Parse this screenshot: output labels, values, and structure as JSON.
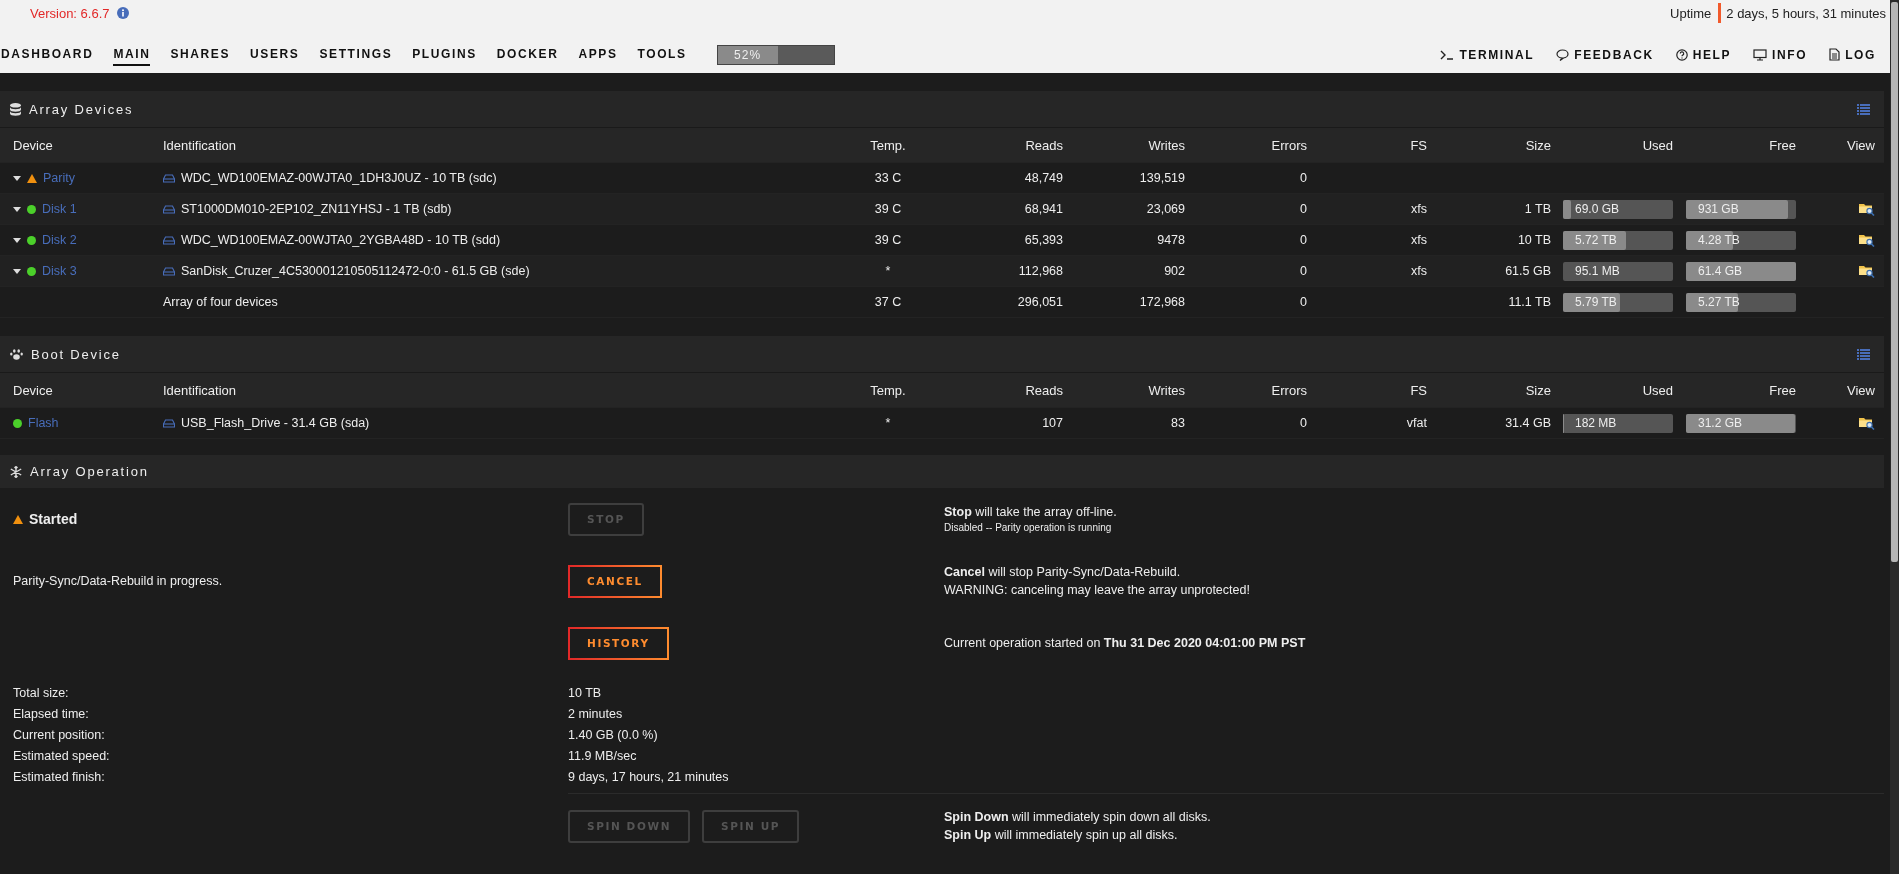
{
  "header": {
    "version": "Version: 6.6.7",
    "uptime_label": "Uptime",
    "uptime": "2 days, 5 hours, 31 minutes"
  },
  "nav": {
    "tabs": [
      {
        "label": "DASHBOARD",
        "selected": false
      },
      {
        "label": "MAIN",
        "selected": true
      },
      {
        "label": "SHARES",
        "selected": false
      },
      {
        "label": "USERS",
        "selected": false
      },
      {
        "label": "SETTINGS",
        "selected": false
      },
      {
        "label": "PLUGINS",
        "selected": false
      },
      {
        "label": "DOCKER",
        "selected": false
      },
      {
        "label": "APPS",
        "selected": false
      },
      {
        "label": "TOOLS",
        "selected": false
      }
    ],
    "progress": {
      "level": 0.52,
      "reading": "52%"
    },
    "links": [
      {
        "label": "TERMINAL",
        "kind": "terminal"
      },
      {
        "label": "FEEDBACK",
        "kind": "feedback"
      },
      {
        "label": "HELP",
        "kind": "help"
      },
      {
        "label": "INFO",
        "kind": "info"
      },
      {
        "label": "LOG",
        "kind": "log"
      }
    ]
  },
  "array_devices": {
    "title": "Array Devices",
    "columns": [
      "Device",
      "Identification",
      "Temp.",
      "Reads",
      "Writes",
      "Errors",
      "FS",
      "Size",
      "Used",
      "Free",
      "View"
    ],
    "rows": [
      {
        "kind": "disk",
        "device": "Parity",
        "warning": true,
        "expandable": true,
        "identification": "WDC_WD100EMAZ-00WJTA0_1DH3J0UZ - 10 TB (sdc)",
        "temp": "33 C",
        "reads": "48,749",
        "writes": "139,519",
        "errors": "0",
        "browsable": false
      },
      {
        "kind": "disk",
        "device": "Disk 1",
        "warning": false,
        "expandable": true,
        "identification": "ST1000DM010-2EP102_ZN11YHSJ - 1 TB (sdb)",
        "temp": "39 C",
        "reads": "68,941",
        "writes": "23,069",
        "errors": "0",
        "fs": "xfs",
        "size": "1 TB",
        "used": {
          "text": "69.0 GB",
          "level": 0.07
        },
        "free": {
          "text": "931 GB",
          "level": 0.93
        },
        "browsable": true
      },
      {
        "kind": "disk",
        "device": "Disk 2",
        "warning": false,
        "expandable": true,
        "identification": "WDC_WD100EMAZ-00WJTA0_2YGBA48D - 10 TB (sdd)",
        "temp": "39 C",
        "reads": "65,393",
        "writes": "9478",
        "errors": "0",
        "fs": "xfs",
        "size": "10 TB",
        "used": {
          "text": "5.72 TB",
          "level": 0.57
        },
        "free": {
          "text": "4.28 TB",
          "level": 0.43
        },
        "browsable": true
      },
      {
        "kind": "disk",
        "device": "Disk 3",
        "warning": false,
        "expandable": true,
        "identification": "SanDisk_Cruzer_4C530001210505112472-0:0 - 61.5 GB (sde)",
        "temp": "*",
        "reads": "112,968",
        "writes": "902",
        "errors": "0",
        "fs": "xfs",
        "size": "61.5 GB",
        "used": {
          "text": "95.1 MB",
          "level": 0.0
        },
        "free": {
          "text": "61.4 GB",
          "level": 1.0
        },
        "browsable": true
      },
      {
        "kind": "total",
        "identification": "Array of four devices",
        "temp": "37 C",
        "reads": "296,051",
        "writes": "172,968",
        "errors": "0",
        "size": "11.1 TB",
        "used": {
          "text": "5.79 TB",
          "level": 0.52
        },
        "free": {
          "text": "5.27 TB",
          "level": 0.47
        },
        "browsable": false
      }
    ]
  },
  "boot_device": {
    "title": "Boot Device",
    "columns": [
      "Device",
      "Identification",
      "Temp.",
      "Reads",
      "Writes",
      "Errors",
      "FS",
      "Size",
      "Used",
      "Free",
      "View"
    ],
    "rows": [
      {
        "kind": "disk",
        "device": "Flash",
        "warning": false,
        "expandable": false,
        "identification": "USB_Flash_Drive - 31.4 GB (sda)",
        "temp": "*",
        "reads": "107",
        "writes": "83",
        "errors": "0",
        "fs": "vfat",
        "size": "31.4 GB",
        "used": {
          "text": "182 MB",
          "level": 0.01
        },
        "free": {
          "text": "31.2 GB",
          "level": 0.99
        },
        "browsable": true
      }
    ]
  },
  "array_operation": {
    "title": "Array Operation",
    "rows": [
      {
        "status": {
          "text": "Started",
          "warning": true
        },
        "button": {
          "label": "STOP",
          "disabled": true
        },
        "description": "**Stop** will take the array off-line.",
        "note": "Disabled -- Parity operation is running"
      },
      {
        "text": "Parity-Sync/Data-Rebuild in progress.",
        "button": {
          "label": "CANCEL",
          "disabled": false
        },
        "description": "**Cancel** will stop Parity-Sync/Data-Rebuild.",
        "note": "WARNING: canceling may leave the array unprotected!"
      },
      {
        "button": {
          "label": "HISTORY",
          "disabled": false
        },
        "description": "Current operation started on **Thu 31 Dec 2020 04:01:00 PM PST**"
      }
    ],
    "stats": [
      {
        "label": "Total size:",
        "value": "10 TB"
      },
      {
        "label": "Elapsed time:",
        "value": "2 minutes"
      },
      {
        "label": "Current position:",
        "value": "1.40 GB (0.0 %)"
      },
      {
        "label": "Estimated speed:",
        "value": "11.9 MB/sec"
      },
      {
        "label": "Estimated finish:",
        "value": "9 days, 17 hours, 21 minutes"
      }
    ],
    "spin": {
      "buttons": [
        {
          "label": "SPIN DOWN",
          "disabled": true
        },
        {
          "label": "SPIN UP",
          "disabled": true
        }
      ],
      "descriptions": [
        "**Spin Down** will immediately spin down all disks.",
        "**Spin Up** will immediately spin up all disks."
      ]
    }
  }
}
